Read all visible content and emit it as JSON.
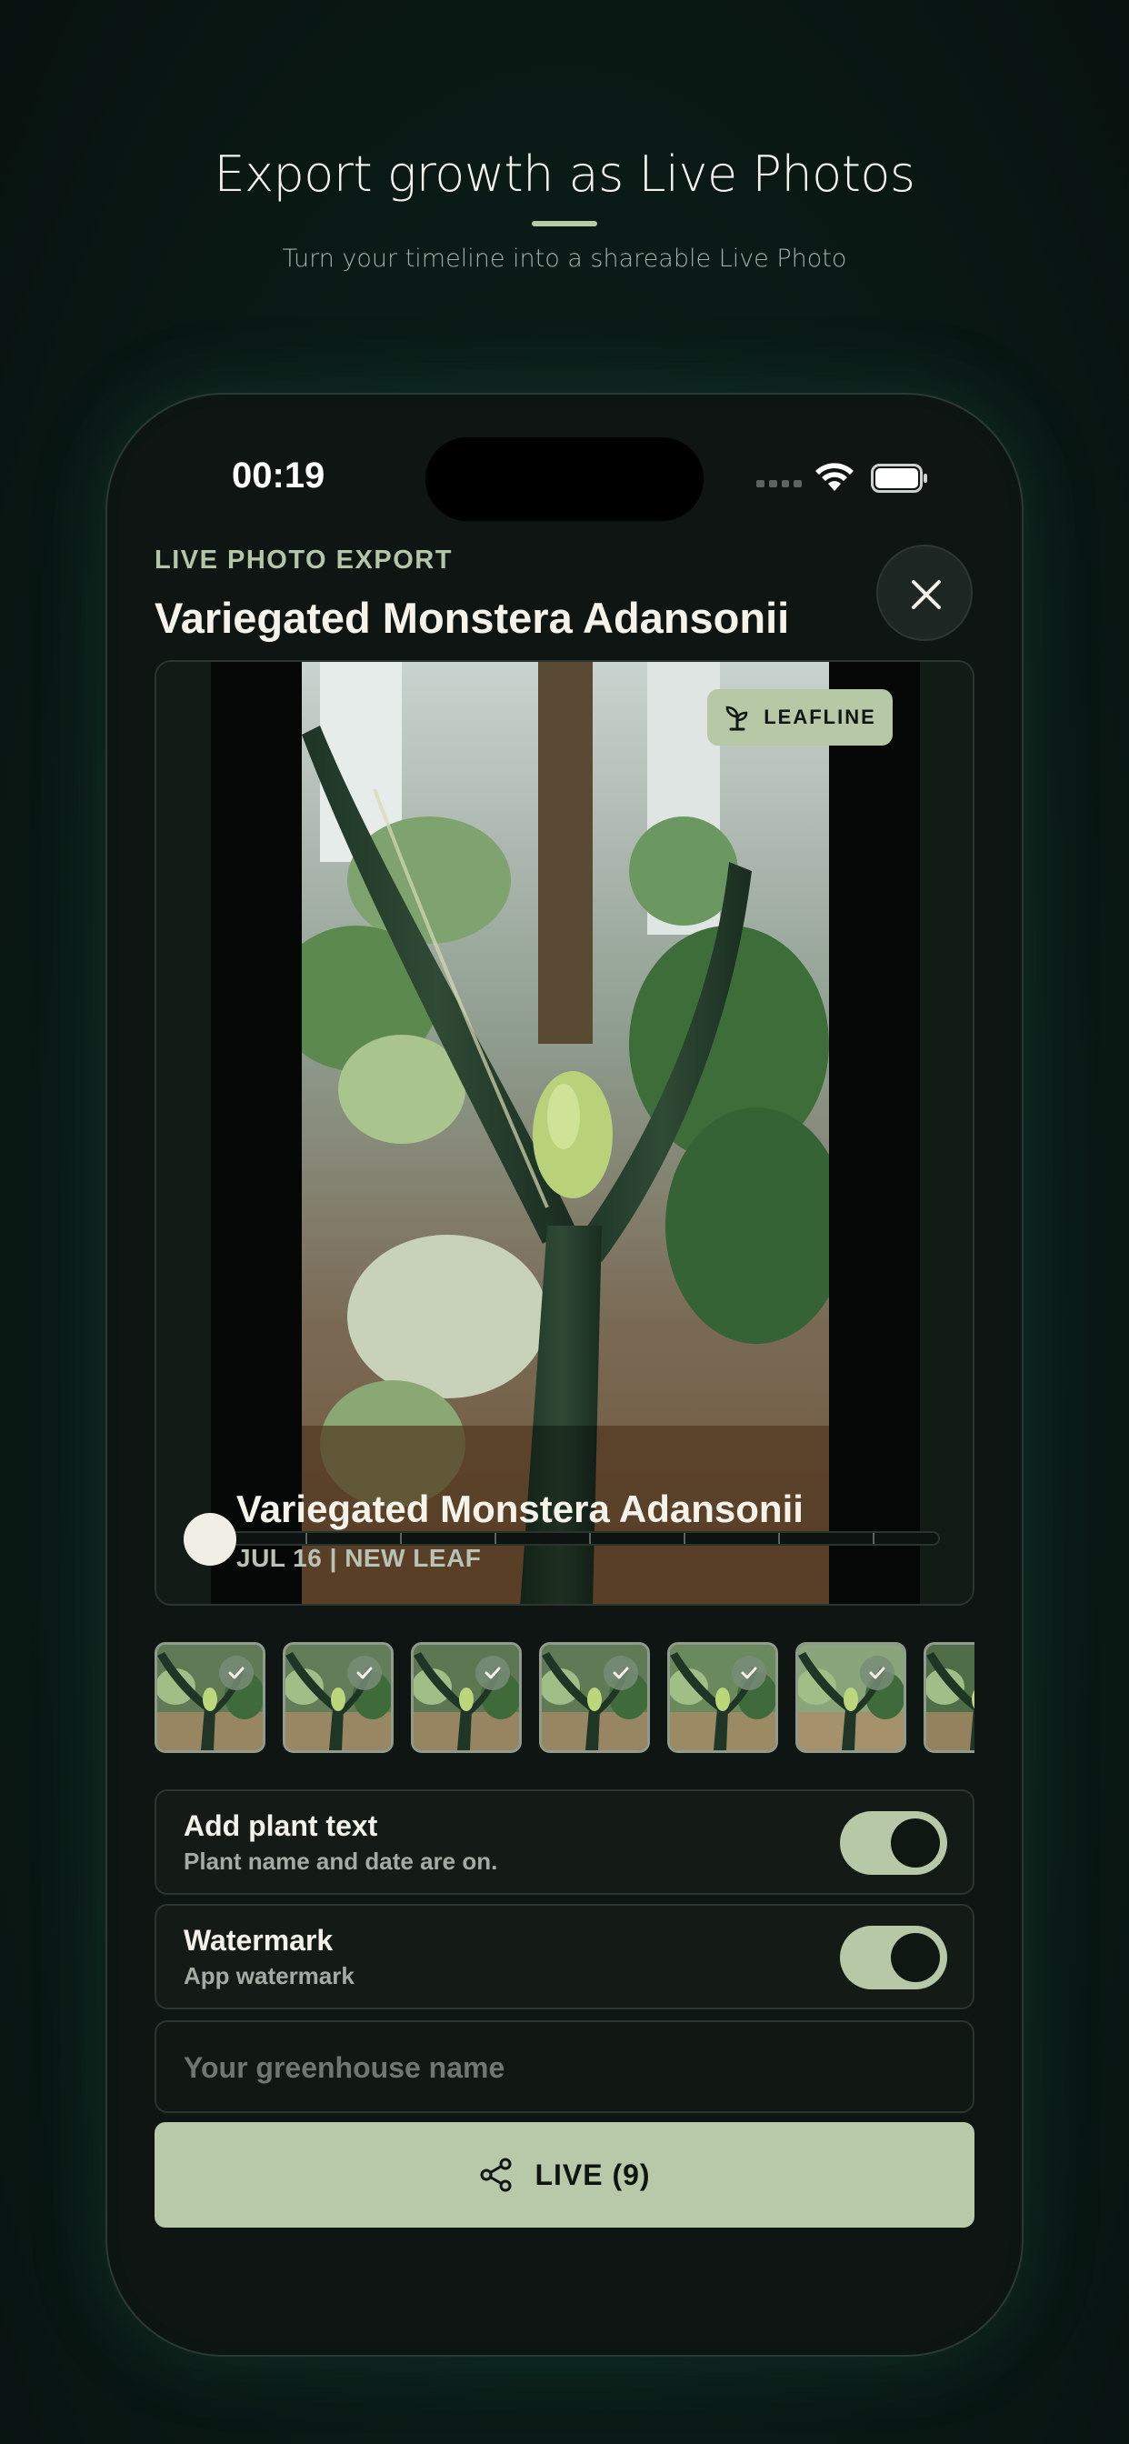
{
  "hero": {
    "title": "Export growth as Live Photos",
    "subtitle": "Turn your timeline into a shareable Live Photo"
  },
  "status_bar": {
    "time": "00:19"
  },
  "header": {
    "eyebrow": "LIVE PHOTO EXPORT",
    "title": "Variegated Monstera Adansonii",
    "close_icon": "close-icon"
  },
  "preview": {
    "badge_label": "LEAFLINE",
    "badge_icon": "sprout-icon",
    "overlay_title": "Variegated Monstera Adansonii",
    "overlay_date": "JUL 16 | NEW LEAF",
    "scrub_position": 0.0
  },
  "thumbnails": [
    {
      "selected": true
    },
    {
      "selected": true
    },
    {
      "selected": true
    },
    {
      "selected": true
    },
    {
      "selected": true
    },
    {
      "selected": true
    },
    {
      "selected": false
    }
  ],
  "options": {
    "plant_text": {
      "title": "Add plant text",
      "subtitle": "Plant name and date are on.",
      "enabled": true
    },
    "watermark": {
      "title": "Watermark",
      "subtitle": "App watermark",
      "enabled": true
    }
  },
  "greenhouse_input": {
    "placeholder": "Your greenhouse name",
    "value": ""
  },
  "cta": {
    "label": "LIVE (9)",
    "icon": "share-icon"
  },
  "colors": {
    "accent": "#b6c8a6",
    "background": "#0b1d18",
    "card": "#141b17",
    "text": "#f6f3ea"
  }
}
